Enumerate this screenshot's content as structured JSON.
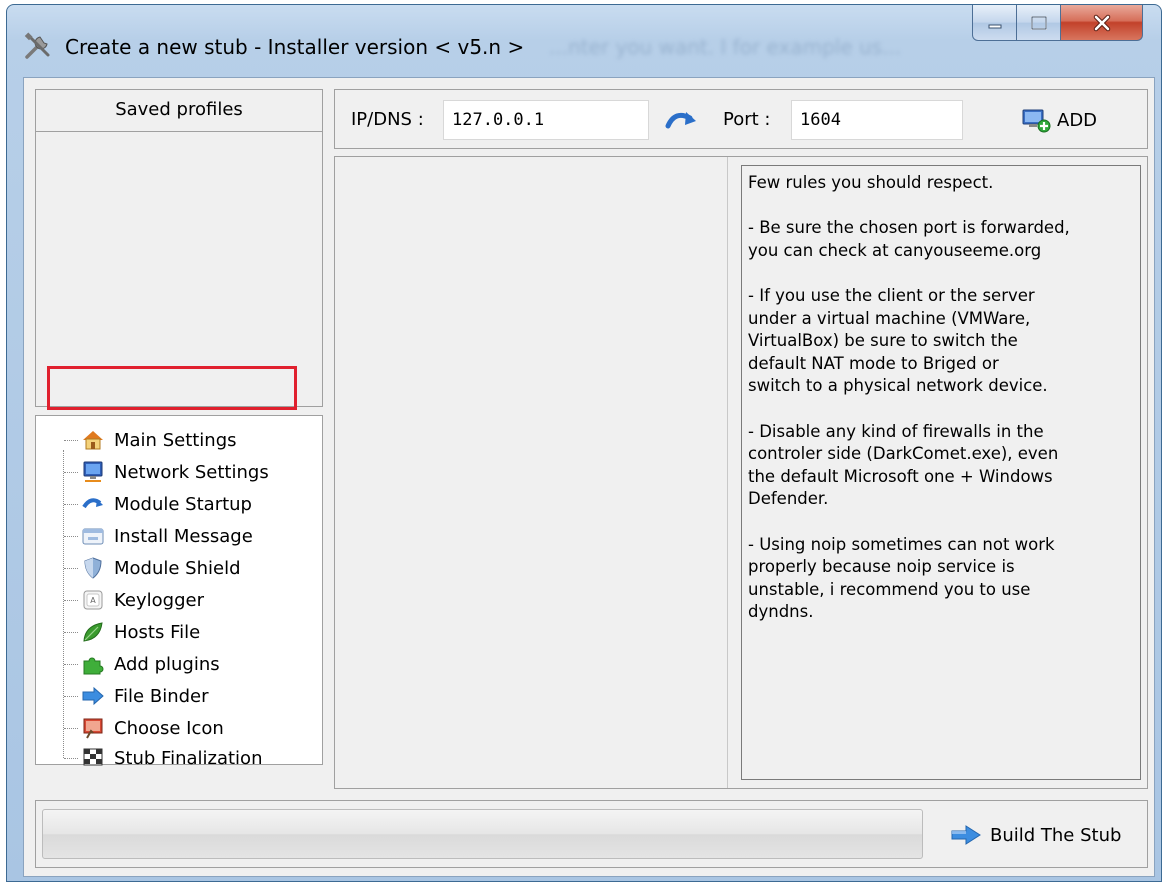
{
  "window": {
    "title": "Create a new stub - Installer version < v5.n >",
    "title_ghost": "...nter you want. I for example us..."
  },
  "profiles": {
    "header": "Saved profiles"
  },
  "tree": {
    "items": [
      {
        "label": "Main Settings",
        "icon": "house-icon"
      },
      {
        "label": "Network Settings",
        "icon": "monitor-network-icon",
        "highlighted": true
      },
      {
        "label": "Module Startup",
        "icon": "startup-arrow-icon"
      },
      {
        "label": "Install Message",
        "icon": "message-window-icon"
      },
      {
        "label": "Module Shield",
        "icon": "shield-icon"
      },
      {
        "label": "Keylogger",
        "icon": "key-icon"
      },
      {
        "label": "Hosts File",
        "icon": "leaf-icon"
      },
      {
        "label": "Add plugins",
        "icon": "puzzle-icon"
      },
      {
        "label": "File Binder",
        "icon": "double-arrow-icon"
      },
      {
        "label": "Choose Icon",
        "icon": "picture-icon"
      },
      {
        "label": "Stub Finalization",
        "icon": "finish-flag-icon"
      }
    ]
  },
  "network": {
    "ip_label": "IP/DNS :",
    "ip_value": "127.0.0.1",
    "port_label": "Port :",
    "port_value": "1604",
    "add_label": "ADD"
  },
  "info": {
    "text": "Few rules you should respect.\n\n- Be sure the chosen port is forwarded,\nyou can check at canyouseeme.org\n\n- If you use the client or the server\nunder a virtual machine (VMWare,\nVirtualBox) be sure to switch the\ndefault NAT mode to Briged or\nswitch to a physical network device.\n\n- Disable any kind of firewalls in the\ncontroler side (DarkComet.exe), even\nthe default Microsoft one + Windows\nDefender.\n\n- Using noip sometimes can not work\nproperly because noip service is\nunstable, i recommend you to use\ndyndns."
  },
  "footer": {
    "build_label": "Build The Stub"
  },
  "colors": {
    "highlight": "#e0202e",
    "panel_bg": "#f0f0f0",
    "frame": "#a9c5e3"
  }
}
